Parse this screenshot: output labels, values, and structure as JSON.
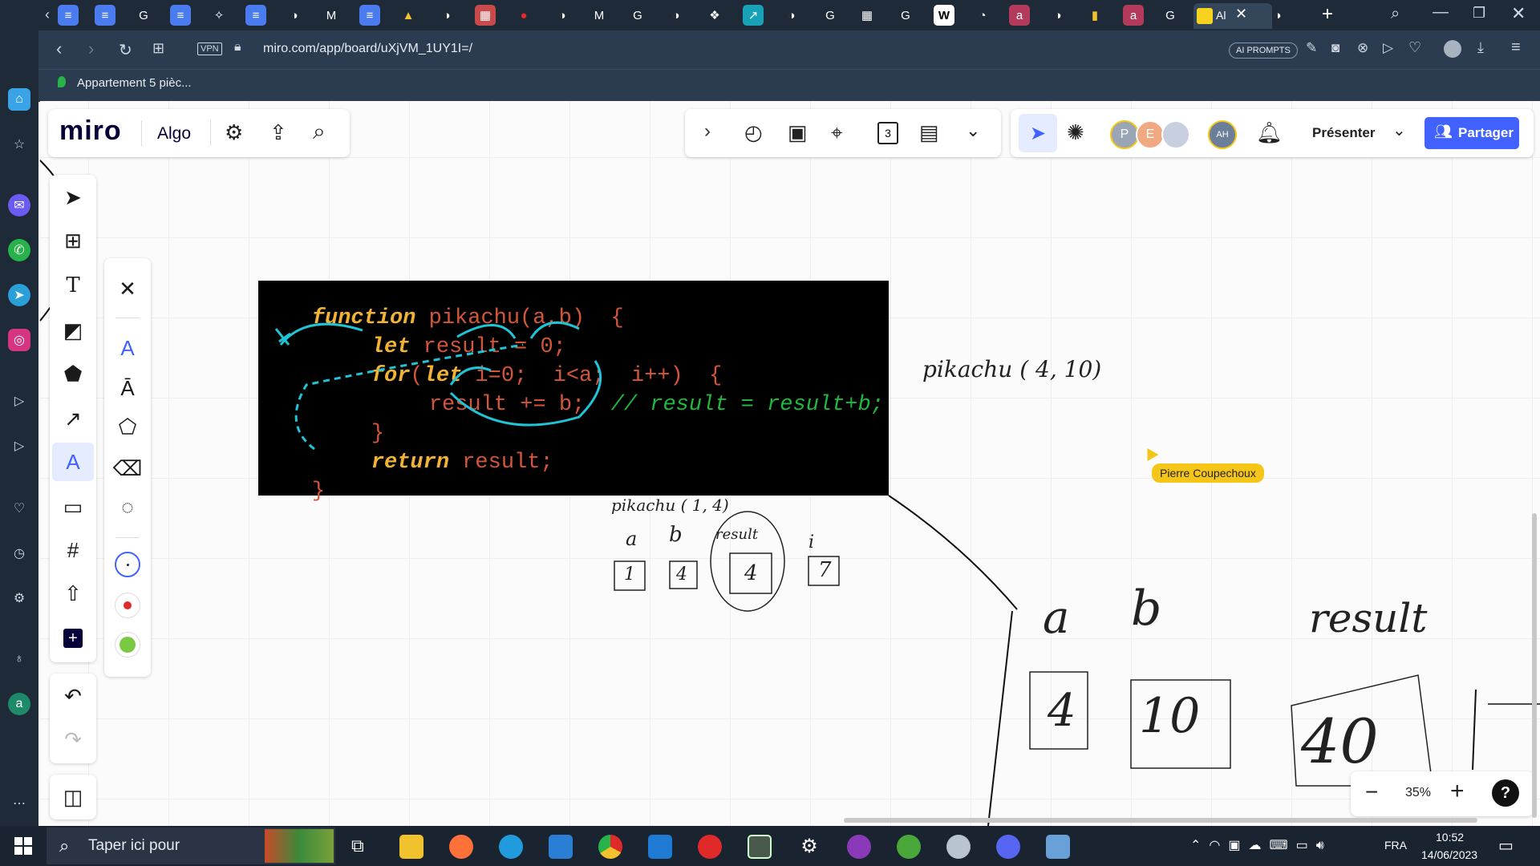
{
  "browser": {
    "url": "miro.com/app/board/uXjVM_1UY1I=/",
    "vpn_label": "VPN",
    "ai_prompts_label": "AI PROMPTS",
    "active_tab_label": "Al",
    "bookmark_label": "Appartement 5 pièc..."
  },
  "miro": {
    "logo": "miro",
    "board_name": "Algo",
    "present_label": "Présenter",
    "share_label": "Partager",
    "avatars": [
      "P",
      "E",
      "",
      "AH"
    ],
    "zoom": "35%",
    "cursor_user": "Pierre Coupechoux"
  },
  "code": {
    "line1_kw": "function",
    "line1_rest": " pikachu(a,b)  {",
    "line2_kw": "let",
    "line2_rest": " result = 0;",
    "line3_kw": "for",
    "line3_kw2": "let",
    "line3_rest": " i=0;  i<a;  i++)  {",
    "line4_code": "result += b;",
    "line4_comment": "// result = result+b;",
    "line5": "}",
    "line6_kw": "return",
    "line6_rest": " result;",
    "line7": "}"
  },
  "handwriting": {
    "call_top": "pikachu ( 4, 10)",
    "call_small": "pikachu ( 1, 4)",
    "small_a": "a",
    "small_b": "b",
    "small_result": "result",
    "small_i": "i",
    "small_val_a": "1",
    "small_val_b": "4",
    "small_val_result": "4",
    "small_val_i": "7",
    "big_a": "a",
    "big_b": "b",
    "big_result": "result",
    "big_val_a": "4",
    "big_val_b": "10",
    "big_val_result": "40"
  },
  "taskbar": {
    "search_placeholder": "Taper ici pour",
    "language": "FRA",
    "time": "10:52",
    "date": "14/06/2023"
  }
}
